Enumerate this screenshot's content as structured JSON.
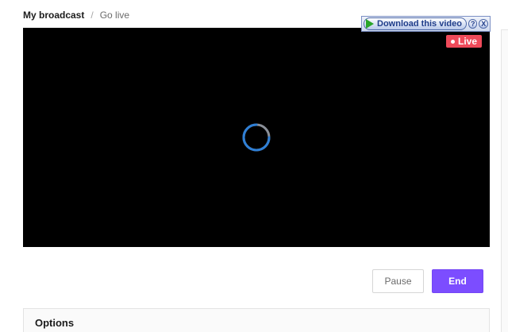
{
  "breadcrumb": {
    "current": "My broadcast",
    "separator": "/",
    "link": "Go live"
  },
  "player": {
    "live_label": "Live",
    "state": "loading",
    "spinner_icon": "loading-spinner-icon"
  },
  "download_overlay": {
    "label": "Download this video",
    "help_label": "?",
    "close_label": "X"
  },
  "actions": {
    "pause_label": "Pause",
    "end_label": "End"
  },
  "options": {
    "title": "Options"
  },
  "colors": {
    "accent": "#7c4dff",
    "live": "#ef4a5a"
  }
}
